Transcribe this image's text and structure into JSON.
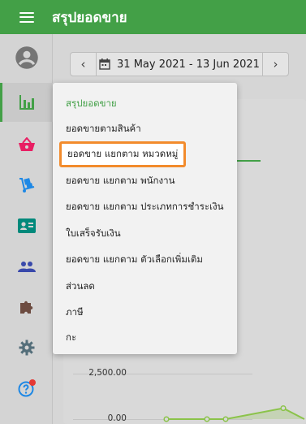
{
  "app": {
    "title": "สรุปยอดขาย"
  },
  "sidebar": {
    "items": [
      {
        "icon": "account-circle-icon"
      },
      {
        "icon": "bar-chart-icon",
        "active": true
      },
      {
        "icon": "basket-icon"
      },
      {
        "icon": "dolly-icon"
      },
      {
        "icon": "contact-card-icon"
      },
      {
        "icon": "people-icon"
      },
      {
        "icon": "puzzle-icon"
      },
      {
        "icon": "gear-icon"
      },
      {
        "icon": "help-icon",
        "badge": true
      }
    ]
  },
  "date_range": {
    "label": "31 May 2021 - 13 Jun 2021",
    "prev_icon": "chevron-left-icon",
    "next_icon": "chevron-right-icon",
    "calendar_icon": "calendar-icon"
  },
  "menu": {
    "header": "สรุปยอดขาย",
    "items": [
      "ยอดขายตามสินค้า",
      "ยอดขาย แยกตาม หมวดหมู่",
      "ยอดขาย แยกตาม พนักงาน",
      "ยอดขาย แยกตาม ประเภทการชำระเงิน",
      "ใบเสร็จรับเงิน",
      "ยอดขาย แยกตาม ตัวเลือกเพิ่มเติม",
      "ส่วนลด",
      "ภาษี",
      "กะ"
    ],
    "highlighted_index": 1
  },
  "chart_data": {
    "type": "line",
    "y_tick_labels": [
      "2,500.00",
      "0.00"
    ],
    "series": [
      {
        "values": [
          0,
          0,
          0,
          600,
          0
        ]
      }
    ],
    "ylim": [
      0,
      2500
    ],
    "color": "#8bc34a"
  }
}
